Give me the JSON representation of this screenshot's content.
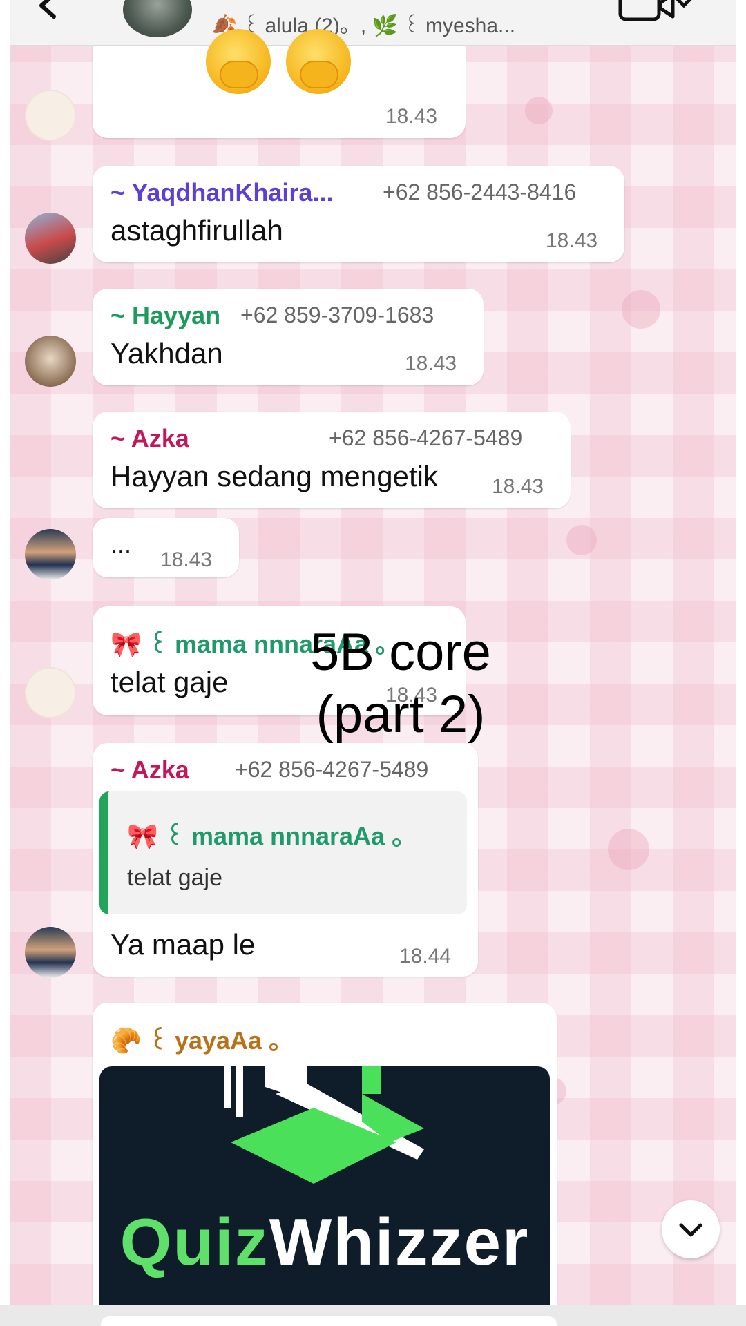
{
  "header": {
    "subtitle": "🍂 ꒰ alula (2)。, 🌿 ꒰ myesha..."
  },
  "messages": [
    {
      "time": "18.43"
    },
    {
      "sender": "~ YaqdhanKhaira...",
      "phone": "+62 856-2443-8416",
      "text": "astaghfirullah",
      "time": "18.43"
    },
    {
      "sender": "~ Hayyan",
      "phone": "+62 859-3709-1683",
      "text": "Yakhdan",
      "time": "18.43"
    },
    {
      "sender": "~ Azka",
      "phone": "+62 856-4267-5489",
      "text": "Hayyan sedang mengetik",
      "time": "18.43"
    },
    {
      "text": "...",
      "time": "18.43"
    },
    {
      "sender": "🎀 ꒰ mama nnnaraAa 。",
      "text": "telat gaje",
      "time": "18.43"
    },
    {
      "sender": "~ Azka",
      "phone": "+62 856-4267-5489",
      "quote": {
        "sender": "🎀 ꒰ mama nnnaraAa 。",
        "text": "telat gaje"
      },
      "text": "Ya maap le",
      "time": "18.44"
    },
    {
      "sender": "🥐 ꒰ yayaAa 。",
      "image_title_part1": "Quiz",
      "image_title_part2": "Whizzer"
    }
  ],
  "overlay": {
    "line1": "5B core",
    "line2": "(part 2)"
  },
  "colors": {
    "yaqdhan": "#5b3fd6",
    "hayyan": "#1d9a5c",
    "azka": "#c2185b",
    "mama": "#1f9a6b",
    "yaya": "#b8731a"
  },
  "icons": [
    "back-icon",
    "video-call-icon",
    "chevron-down-icon"
  ]
}
